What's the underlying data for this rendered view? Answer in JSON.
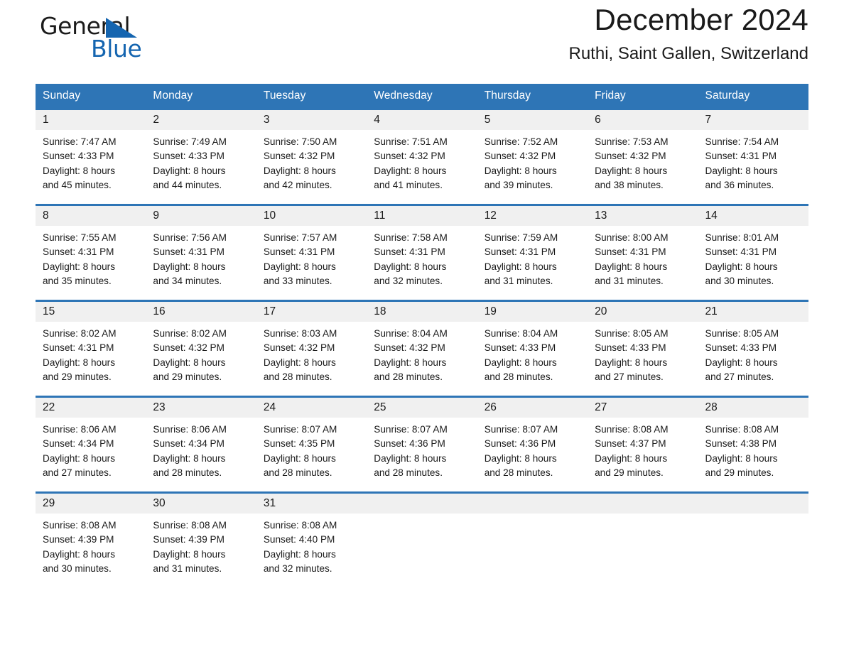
{
  "brand": {
    "name_part1": "General",
    "name_part2": "Blue",
    "flag_icon": "blue-triangle-flag-icon",
    "accent_color": "#1565b0"
  },
  "header": {
    "month_title": "December 2024",
    "location": "Ruthi, Saint Gallen, Switzerland"
  },
  "theme": {
    "header_blue": "#2e75b6",
    "day_band_gray": "#f0f0f0",
    "text_color": "#1a1a1a"
  },
  "calendar": {
    "weekday_headers": [
      "Sunday",
      "Monday",
      "Tuesday",
      "Wednesday",
      "Thursday",
      "Friday",
      "Saturday"
    ],
    "weeks": [
      [
        {
          "day": "1",
          "sunrise": "Sunrise: 7:47 AM",
          "sunset": "Sunset: 4:33 PM",
          "daylight_line1": "Daylight: 8 hours",
          "daylight_line2": "and 45 minutes."
        },
        {
          "day": "2",
          "sunrise": "Sunrise: 7:49 AM",
          "sunset": "Sunset: 4:33 PM",
          "daylight_line1": "Daylight: 8 hours",
          "daylight_line2": "and 44 minutes."
        },
        {
          "day": "3",
          "sunrise": "Sunrise: 7:50 AM",
          "sunset": "Sunset: 4:32 PM",
          "daylight_line1": "Daylight: 8 hours",
          "daylight_line2": "and 42 minutes."
        },
        {
          "day": "4",
          "sunrise": "Sunrise: 7:51 AM",
          "sunset": "Sunset: 4:32 PM",
          "daylight_line1": "Daylight: 8 hours",
          "daylight_line2": "and 41 minutes."
        },
        {
          "day": "5",
          "sunrise": "Sunrise: 7:52 AM",
          "sunset": "Sunset: 4:32 PM",
          "daylight_line1": "Daylight: 8 hours",
          "daylight_line2": "and 39 minutes."
        },
        {
          "day": "6",
          "sunrise": "Sunrise: 7:53 AM",
          "sunset": "Sunset: 4:32 PM",
          "daylight_line1": "Daylight: 8 hours",
          "daylight_line2": "and 38 minutes."
        },
        {
          "day": "7",
          "sunrise": "Sunrise: 7:54 AM",
          "sunset": "Sunset: 4:31 PM",
          "daylight_line1": "Daylight: 8 hours",
          "daylight_line2": "and 36 minutes."
        }
      ],
      [
        {
          "day": "8",
          "sunrise": "Sunrise: 7:55 AM",
          "sunset": "Sunset: 4:31 PM",
          "daylight_line1": "Daylight: 8 hours",
          "daylight_line2": "and 35 minutes."
        },
        {
          "day": "9",
          "sunrise": "Sunrise: 7:56 AM",
          "sunset": "Sunset: 4:31 PM",
          "daylight_line1": "Daylight: 8 hours",
          "daylight_line2": "and 34 minutes."
        },
        {
          "day": "10",
          "sunrise": "Sunrise: 7:57 AM",
          "sunset": "Sunset: 4:31 PM",
          "daylight_line1": "Daylight: 8 hours",
          "daylight_line2": "and 33 minutes."
        },
        {
          "day": "11",
          "sunrise": "Sunrise: 7:58 AM",
          "sunset": "Sunset: 4:31 PM",
          "daylight_line1": "Daylight: 8 hours",
          "daylight_line2": "and 32 minutes."
        },
        {
          "day": "12",
          "sunrise": "Sunrise: 7:59 AM",
          "sunset": "Sunset: 4:31 PM",
          "daylight_line1": "Daylight: 8 hours",
          "daylight_line2": "and 31 minutes."
        },
        {
          "day": "13",
          "sunrise": "Sunrise: 8:00 AM",
          "sunset": "Sunset: 4:31 PM",
          "daylight_line1": "Daylight: 8 hours",
          "daylight_line2": "and 31 minutes."
        },
        {
          "day": "14",
          "sunrise": "Sunrise: 8:01 AM",
          "sunset": "Sunset: 4:31 PM",
          "daylight_line1": "Daylight: 8 hours",
          "daylight_line2": "and 30 minutes."
        }
      ],
      [
        {
          "day": "15",
          "sunrise": "Sunrise: 8:02 AM",
          "sunset": "Sunset: 4:31 PM",
          "daylight_line1": "Daylight: 8 hours",
          "daylight_line2": "and 29 minutes."
        },
        {
          "day": "16",
          "sunrise": "Sunrise: 8:02 AM",
          "sunset": "Sunset: 4:32 PM",
          "daylight_line1": "Daylight: 8 hours",
          "daylight_line2": "and 29 minutes."
        },
        {
          "day": "17",
          "sunrise": "Sunrise: 8:03 AM",
          "sunset": "Sunset: 4:32 PM",
          "daylight_line1": "Daylight: 8 hours",
          "daylight_line2": "and 28 minutes."
        },
        {
          "day": "18",
          "sunrise": "Sunrise: 8:04 AM",
          "sunset": "Sunset: 4:32 PM",
          "daylight_line1": "Daylight: 8 hours",
          "daylight_line2": "and 28 minutes."
        },
        {
          "day": "19",
          "sunrise": "Sunrise: 8:04 AM",
          "sunset": "Sunset: 4:33 PM",
          "daylight_line1": "Daylight: 8 hours",
          "daylight_line2": "and 28 minutes."
        },
        {
          "day": "20",
          "sunrise": "Sunrise: 8:05 AM",
          "sunset": "Sunset: 4:33 PM",
          "daylight_line1": "Daylight: 8 hours",
          "daylight_line2": "and 27 minutes."
        },
        {
          "day": "21",
          "sunrise": "Sunrise: 8:05 AM",
          "sunset": "Sunset: 4:33 PM",
          "daylight_line1": "Daylight: 8 hours",
          "daylight_line2": "and 27 minutes."
        }
      ],
      [
        {
          "day": "22",
          "sunrise": "Sunrise: 8:06 AM",
          "sunset": "Sunset: 4:34 PM",
          "daylight_line1": "Daylight: 8 hours",
          "daylight_line2": "and 27 minutes."
        },
        {
          "day": "23",
          "sunrise": "Sunrise: 8:06 AM",
          "sunset": "Sunset: 4:34 PM",
          "daylight_line1": "Daylight: 8 hours",
          "daylight_line2": "and 28 minutes."
        },
        {
          "day": "24",
          "sunrise": "Sunrise: 8:07 AM",
          "sunset": "Sunset: 4:35 PM",
          "daylight_line1": "Daylight: 8 hours",
          "daylight_line2": "and 28 minutes."
        },
        {
          "day": "25",
          "sunrise": "Sunrise: 8:07 AM",
          "sunset": "Sunset: 4:36 PM",
          "daylight_line1": "Daylight: 8 hours",
          "daylight_line2": "and 28 minutes."
        },
        {
          "day": "26",
          "sunrise": "Sunrise: 8:07 AM",
          "sunset": "Sunset: 4:36 PM",
          "daylight_line1": "Daylight: 8 hours",
          "daylight_line2": "and 28 minutes."
        },
        {
          "day": "27",
          "sunrise": "Sunrise: 8:08 AM",
          "sunset": "Sunset: 4:37 PM",
          "daylight_line1": "Daylight: 8 hours",
          "daylight_line2": "and 29 minutes."
        },
        {
          "day": "28",
          "sunrise": "Sunrise: 8:08 AM",
          "sunset": "Sunset: 4:38 PM",
          "daylight_line1": "Daylight: 8 hours",
          "daylight_line2": "and 29 minutes."
        }
      ],
      [
        {
          "day": "29",
          "sunrise": "Sunrise: 8:08 AM",
          "sunset": "Sunset: 4:39 PM",
          "daylight_line1": "Daylight: 8 hours",
          "daylight_line2": "and 30 minutes."
        },
        {
          "day": "30",
          "sunrise": "Sunrise: 8:08 AM",
          "sunset": "Sunset: 4:39 PM",
          "daylight_line1": "Daylight: 8 hours",
          "daylight_line2": "and 31 minutes."
        },
        {
          "day": "31",
          "sunrise": "Sunrise: 8:08 AM",
          "sunset": "Sunset: 4:40 PM",
          "daylight_line1": "Daylight: 8 hours",
          "daylight_line2": "and 32 minutes."
        },
        {
          "day": "",
          "sunrise": "",
          "sunset": "",
          "daylight_line1": "",
          "daylight_line2": ""
        },
        {
          "day": "",
          "sunrise": "",
          "sunset": "",
          "daylight_line1": "",
          "daylight_line2": ""
        },
        {
          "day": "",
          "sunrise": "",
          "sunset": "",
          "daylight_line1": "",
          "daylight_line2": ""
        },
        {
          "day": "",
          "sunrise": "",
          "sunset": "",
          "daylight_line1": "",
          "daylight_line2": ""
        }
      ]
    ]
  }
}
